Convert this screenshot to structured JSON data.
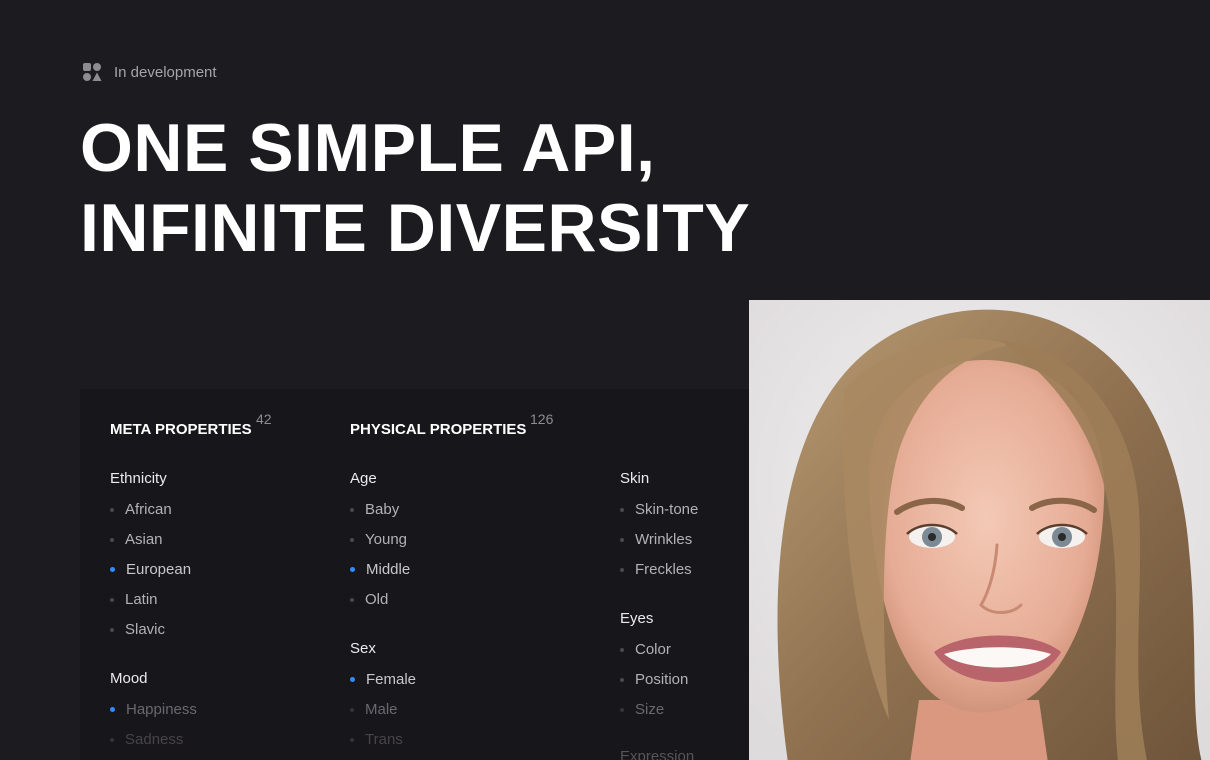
{
  "badge": {
    "icon": "shapes-icon",
    "label": "In development"
  },
  "headline": {
    "line1": "ONE SIMPLE API,",
    "line2": "INFINITE DIVERSITY"
  },
  "meta": {
    "title": "META PROPERTIES",
    "count": "42",
    "ethnicity": {
      "label": "Ethnicity",
      "options": [
        "African",
        "Asian",
        "European",
        "Latin",
        "Slavic"
      ],
      "selected": "European"
    },
    "mood": {
      "label": "Mood",
      "options": [
        "Happiness",
        "Sadness"
      ],
      "selected": "Happiness"
    }
  },
  "physical": {
    "title": "PHYSICAL PROPERTIES",
    "count": "126",
    "age": {
      "label": "Age",
      "options": [
        "Baby",
        "Young",
        "Middle",
        "Old"
      ],
      "selected": "Middle"
    },
    "sex": {
      "label": "Sex",
      "options": [
        "Female",
        "Male",
        "Trans"
      ],
      "selected": "Female"
    },
    "skin": {
      "label": "Skin",
      "options": [
        "Skin-tone",
        "Wrinkles",
        "Freckles"
      ]
    },
    "eyes": {
      "label": "Eyes",
      "options": [
        "Color",
        "Position",
        "Size"
      ]
    },
    "expression": {
      "label": "Expression"
    }
  },
  "colors": {
    "background": "#1c1b1f",
    "panel": "#17161a",
    "accent": "#2f8cff"
  }
}
